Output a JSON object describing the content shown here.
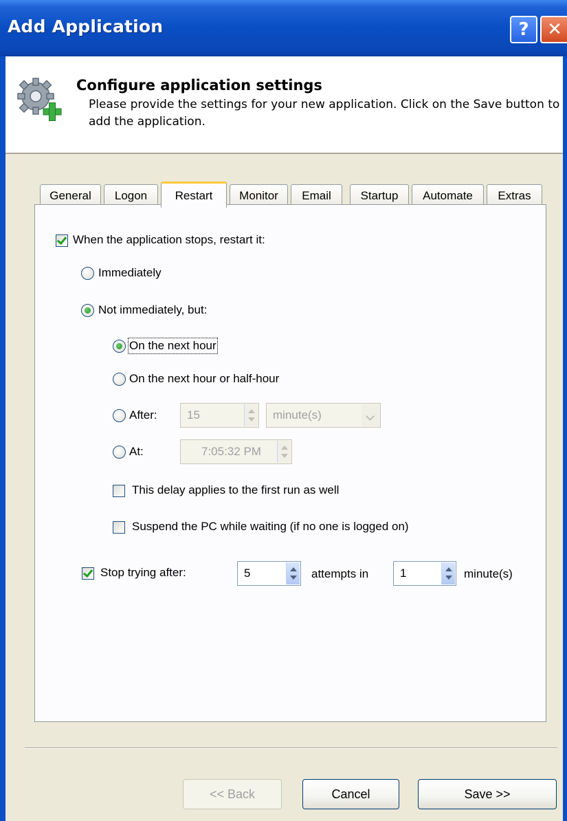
{
  "window": {
    "title": "Add Application",
    "help_label": "?",
    "close_label": "✕"
  },
  "header": {
    "icon": "gear-plus-icon",
    "title": "Configure application settings",
    "description": "Please provide the settings for your new application. Click on the Save button to add the application."
  },
  "tabs": [
    {
      "label": "General"
    },
    {
      "label": "Logon"
    },
    {
      "label": "Restart",
      "active": true
    },
    {
      "label": "Monitor"
    },
    {
      "label": "Email"
    },
    {
      "label": "Startup"
    },
    {
      "label": "Automate"
    },
    {
      "label": "Extras"
    }
  ],
  "restart": {
    "restart_label": "When the application stops, restart it:",
    "restart_checked": true,
    "immediately_label": "Immediately",
    "not_immediately_label": "Not immediately, but:",
    "next_hour_label": "On the next hour",
    "next_half_hour_label": "On the next hour or half-hour",
    "after_label": "After:",
    "after_value": "15",
    "after_unit": "minute(s)",
    "at_label": "At:",
    "at_value": "7:05:32 PM",
    "first_run_label": "This delay applies to the first run as well",
    "suspend_label": "Suspend the PC while waiting (if no one is logged on)",
    "stop_trying_label": "Stop trying after:",
    "stop_trying_checked": true,
    "attempts_value": "5",
    "attempts_in_label": "attempts in",
    "minutes_value": "1",
    "minutes_unit": "minute(s)"
  },
  "buttons": {
    "back": "<< Back",
    "cancel": "Cancel",
    "save": "Save >>"
  },
  "colors": {
    "title_bar": "#0a4ec4",
    "window_bg": "#ece9d8",
    "close_button": "#d24a20",
    "active_tab_highlight": "#ffc83c"
  }
}
